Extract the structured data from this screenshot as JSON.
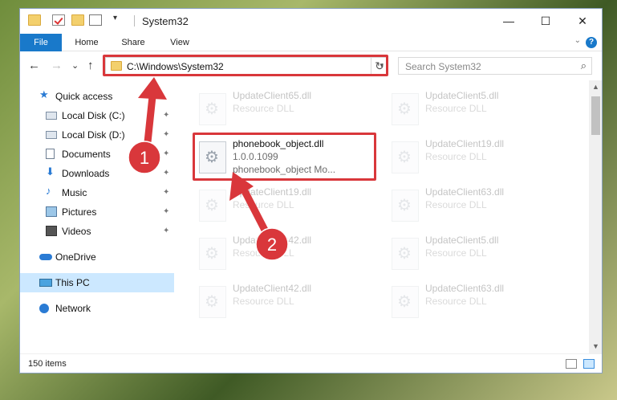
{
  "window": {
    "title": "System32",
    "controls": {
      "minimize": "—",
      "maximize": "☐",
      "close": "✕"
    }
  },
  "ribbon": {
    "tabs": [
      "File",
      "Home",
      "Share",
      "View"
    ],
    "help": "?",
    "collapse": "⌄"
  },
  "navigation": {
    "back": "←",
    "forward": "→",
    "recent": "⌄",
    "up": "↑",
    "address": "C:\\Windows\\System32",
    "refresh": "↻",
    "search_placeholder": "Search System32",
    "search_icon": "⌕"
  },
  "sidebar": {
    "items": [
      {
        "label": "Quick access",
        "icon": "star-icon",
        "pinned": false
      },
      {
        "label": "Local Disk (C:)",
        "icon": "disk-icon",
        "pinned": true
      },
      {
        "label": "Local Disk (D:)",
        "icon": "disk-icon",
        "pinned": true
      },
      {
        "label": "Documents",
        "icon": "documents-icon",
        "pinned": true
      },
      {
        "label": "Downloads",
        "icon": "downloads-icon",
        "pinned": true
      },
      {
        "label": "Music",
        "icon": "music-icon",
        "pinned": true
      },
      {
        "label": "Pictures",
        "icon": "pictures-icon",
        "pinned": true
      },
      {
        "label": "Videos",
        "icon": "videos-icon",
        "pinned": true
      },
      {
        "label": "OneDrive",
        "icon": "onedrive-icon",
        "pinned": false
      },
      {
        "label": "This PC",
        "icon": "this-pc-icon",
        "pinned": false,
        "selected": true
      },
      {
        "label": "Network",
        "icon": "network-icon",
        "pinned": false
      }
    ],
    "pin_glyph": "📌"
  },
  "files": {
    "left_column": [
      {
        "name": "UpdateClient65.dll",
        "line2": "Resource DLL",
        "line3": ""
      },
      {
        "name": "phonebook_object.dll",
        "line2": "1.0.0.1099",
        "line3": "phonebook_object Mo..."
      },
      {
        "name": "UpdateClient19.dll",
        "line2": "Resource DLL",
        "line3": ""
      },
      {
        "name": "UpdateClient42.dll",
        "line2": "Resource DLL",
        "line3": ""
      },
      {
        "name": "UpdateClient42.dll",
        "line2": "Resource DLL",
        "line3": ""
      }
    ],
    "right_column": [
      {
        "name": "UpdateClient5.dll",
        "line2": "Resource DLL",
        "line3": ""
      },
      {
        "name": "UpdateClient19.dll",
        "line2": "Resource DLL",
        "line3": ""
      },
      {
        "name": "UpdateClient63.dll",
        "line2": "Resource DLL",
        "line3": ""
      },
      {
        "name": "UpdateClient5.dll",
        "line2": "Resource DLL",
        "line3": ""
      },
      {
        "name": "UpdateClient63.dll",
        "line2": "Resource DLL",
        "line3": ""
      }
    ]
  },
  "status": {
    "item_count": "150 items"
  },
  "annotations": {
    "step1": "1",
    "step2": "2",
    "highlight_color": "#d9373b"
  }
}
